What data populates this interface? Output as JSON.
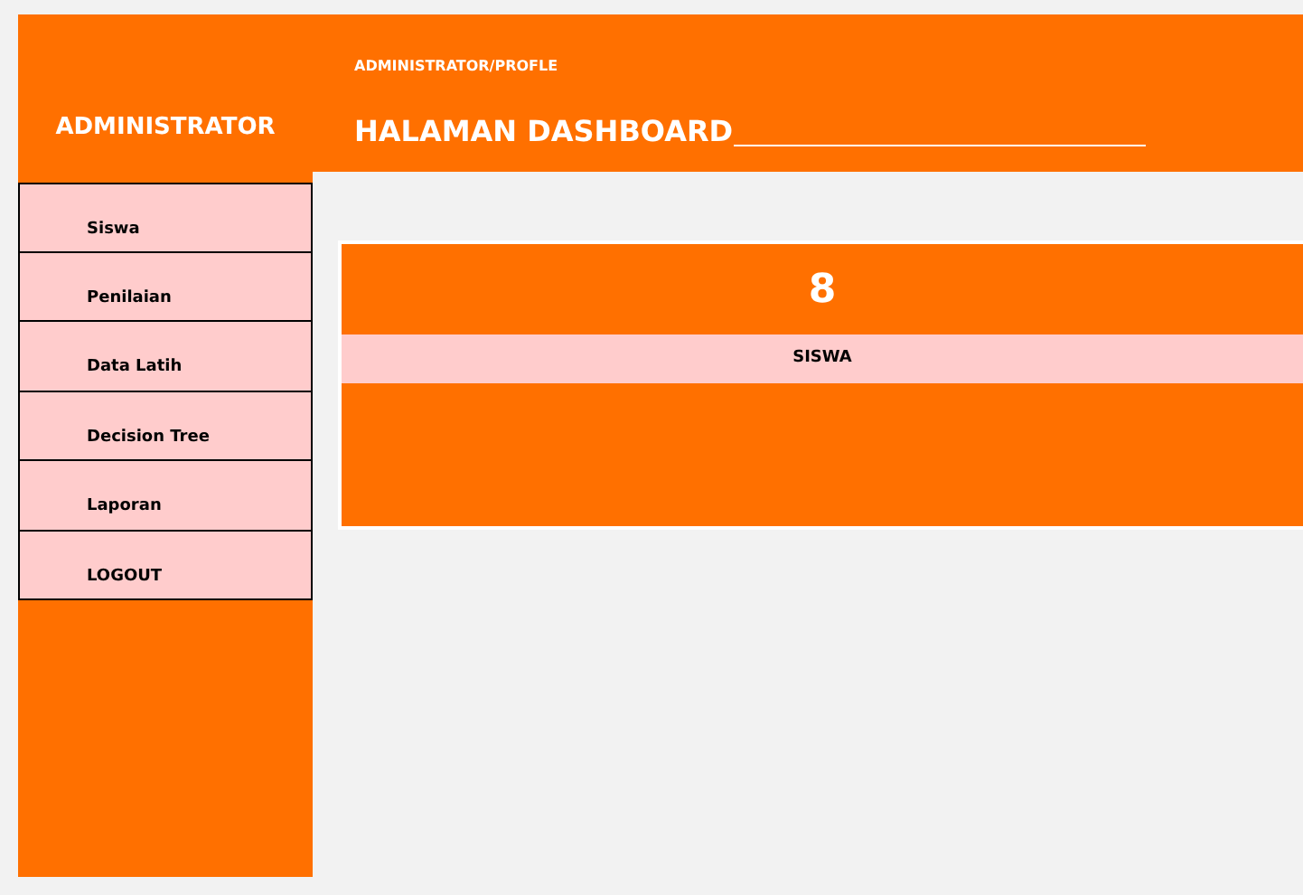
{
  "sidebar": {
    "title": "ADMINISTRATOR",
    "items": [
      {
        "label": "Siswa"
      },
      {
        "label": "Penilaian"
      },
      {
        "label": "Data Latih"
      },
      {
        "label": "Decision Tree"
      },
      {
        "label": "Laporan"
      },
      {
        "label": "LOGOUT"
      }
    ]
  },
  "header": {
    "breadcrumb": "ADMINISTRATOR/PROFLE",
    "title": "HALAMAN DASHBOARD"
  },
  "stat_card": {
    "value": "8",
    "label": "SISWA"
  }
}
